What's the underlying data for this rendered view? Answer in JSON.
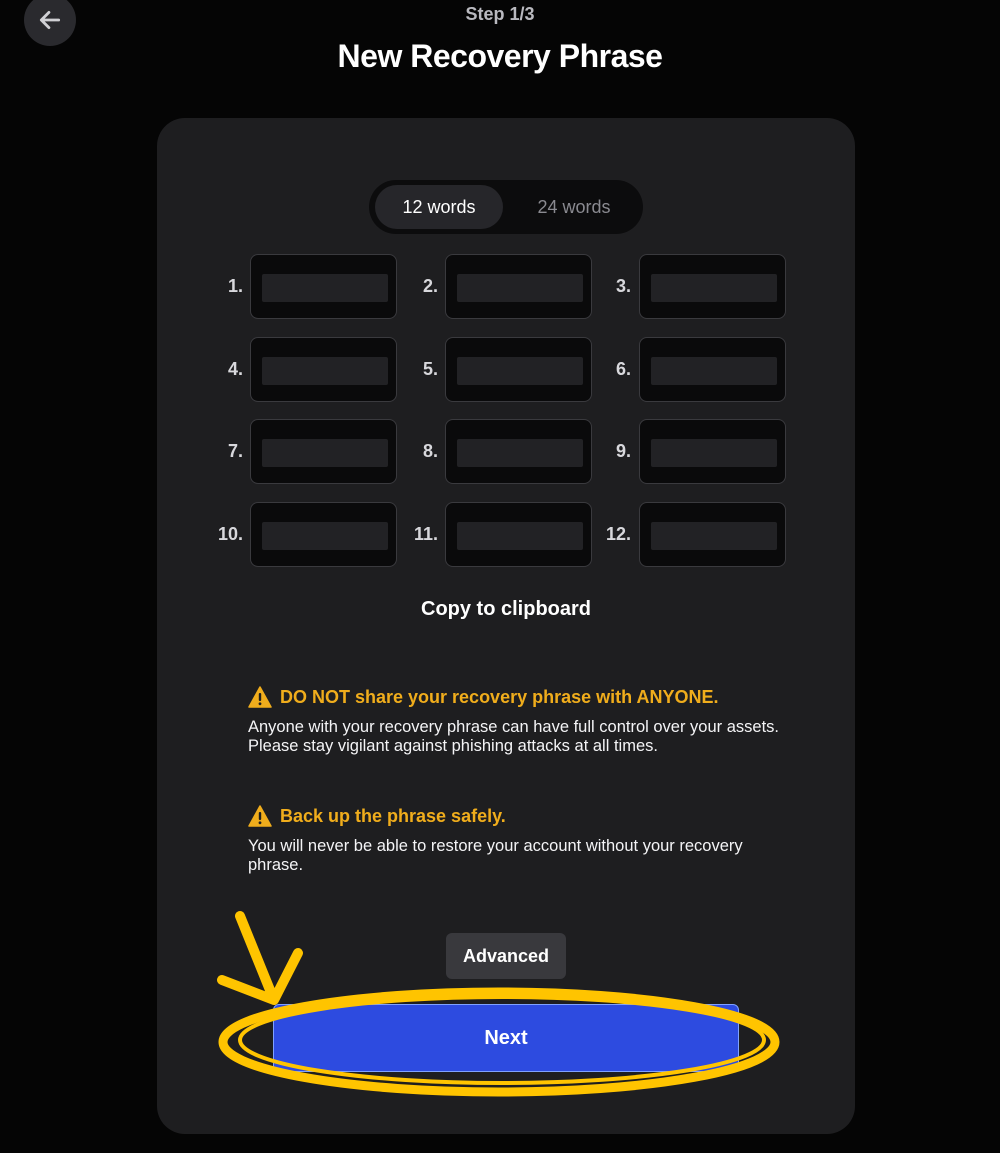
{
  "header": {
    "step": "Step 1/3",
    "title": "New Recovery Phrase",
    "back_icon": "arrow-left-icon"
  },
  "word_count_toggle": {
    "options": [
      "12 words",
      "24 words"
    ],
    "selected": "12 words"
  },
  "words": {
    "numbers": [
      "1.",
      "2.",
      "3.",
      "4.",
      "5.",
      "6.",
      "7.",
      "8.",
      "9.",
      "10.",
      "11.",
      "12."
    ]
  },
  "copy_label": "Copy to clipboard",
  "warnings": [
    {
      "icon": "warning-triangle-icon",
      "title": "DO NOT share your recovery phrase with ANYONE.",
      "body": "Anyone with your recovery phrase can have full control over your assets. Please stay vigilant against phishing attacks at all times."
    },
    {
      "icon": "warning-triangle-icon",
      "title": "Back up the phrase safely.",
      "body": "You will never be able to restore your account without your recovery phrase."
    }
  ],
  "buttons": {
    "advanced": "Advanced",
    "next": "Next"
  },
  "colors": {
    "background": "#050505",
    "card": "#1e1e20",
    "warning": "#f0ad1c",
    "primary": "#2d4be0",
    "annotation": "#ffc400"
  }
}
